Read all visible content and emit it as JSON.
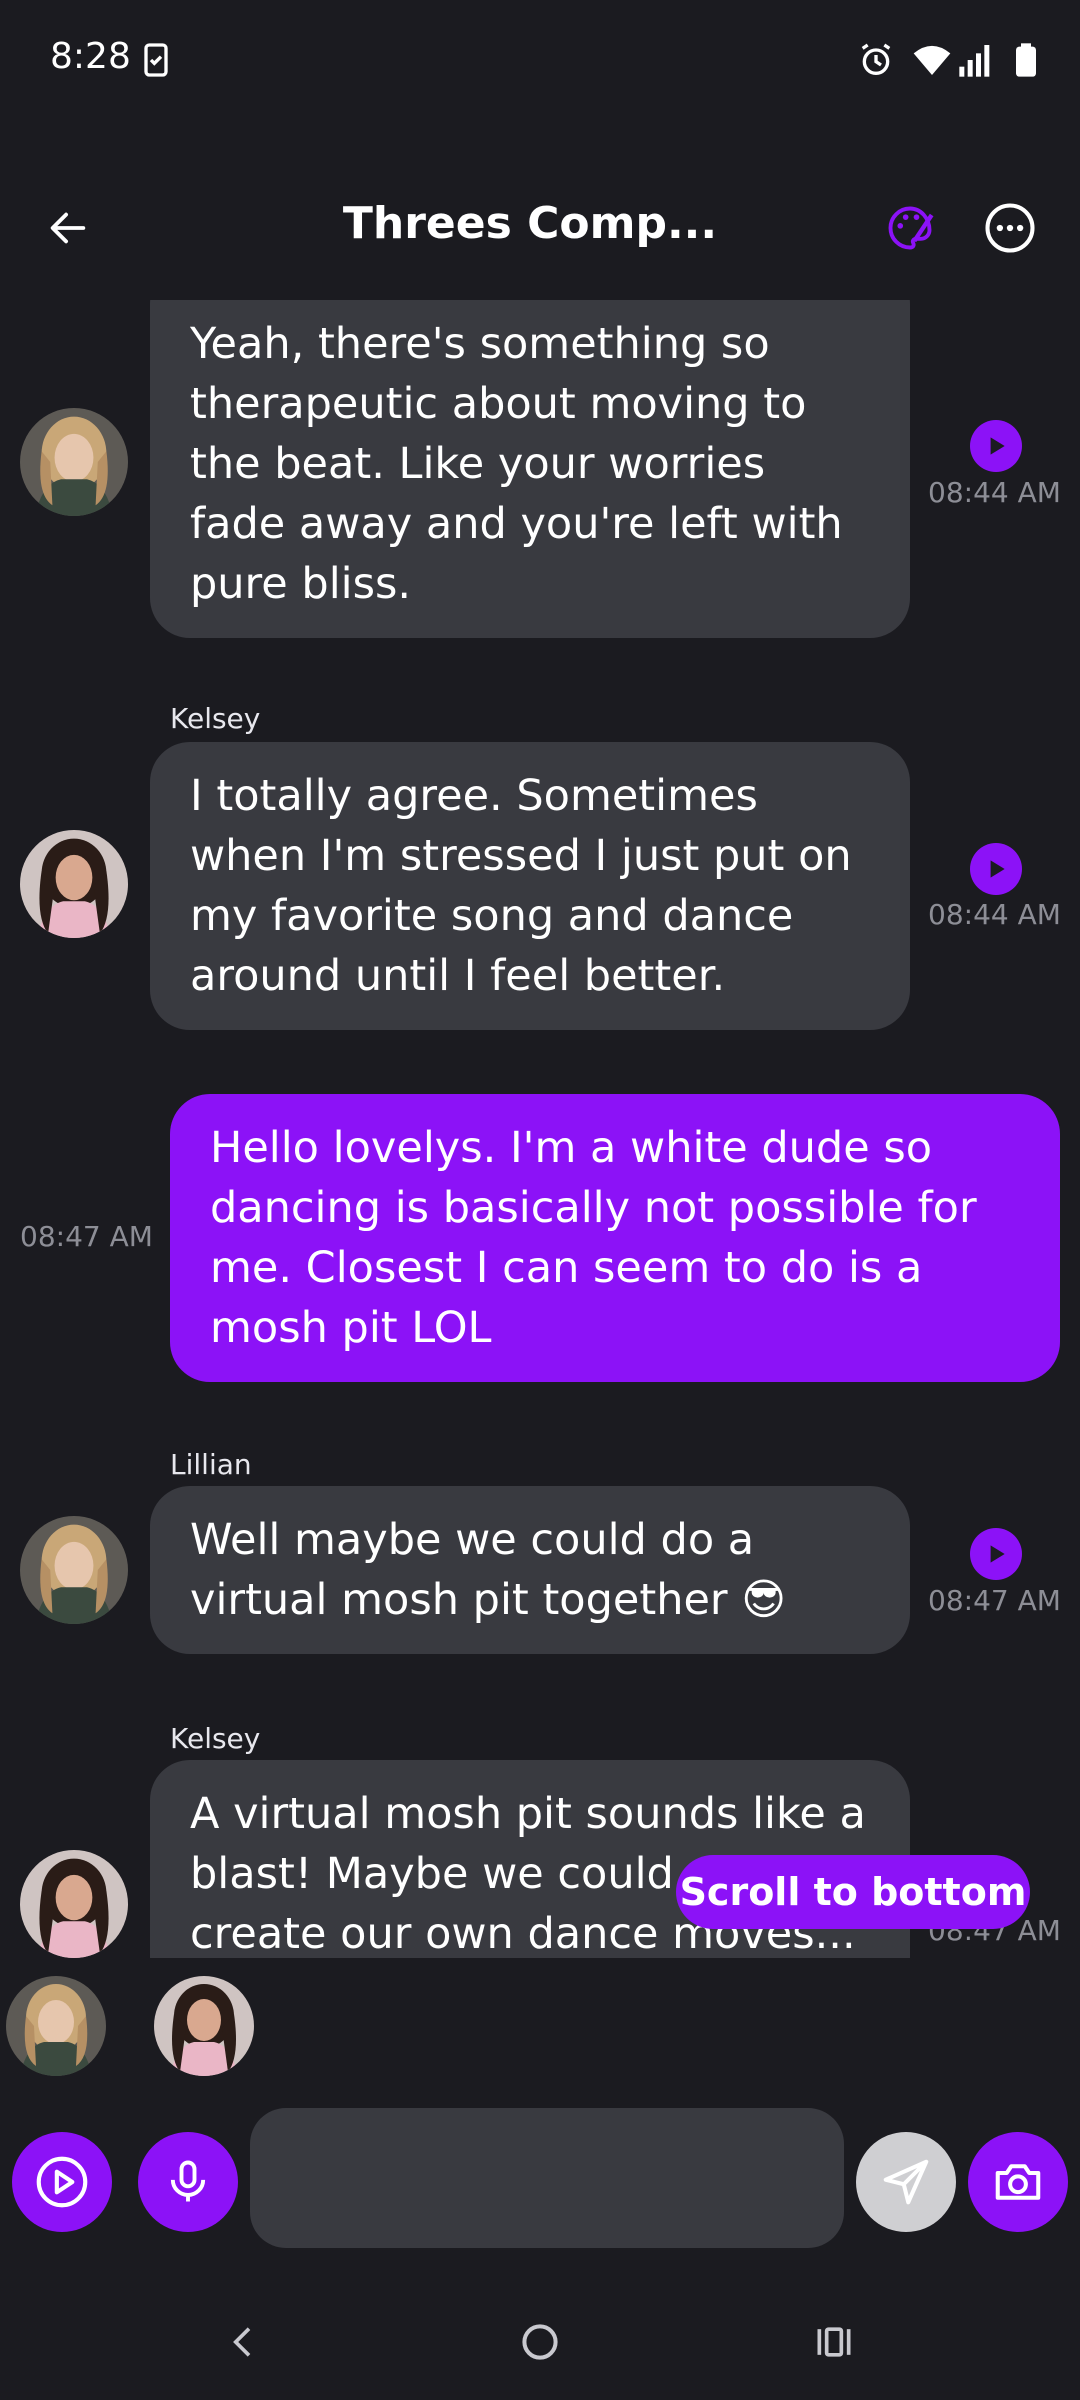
{
  "status_bar": {
    "time": "8:28",
    "icons": [
      "clipboard-icon",
      "alarm-icon",
      "wifi-icon",
      "signal-icon",
      "battery-icon"
    ]
  },
  "header": {
    "title": "Threes Comp...",
    "back_icon": "back-arrow-icon",
    "theme_icon": "palette-icon",
    "more_icon": "more-options-icon"
  },
  "messages": [
    {
      "sender": "",
      "text": "Yeah, there's something so therapeutic about moving to the beat. Like your worries fade away and you're left with pure bliss.",
      "time": "08:44 AM",
      "own": false
    },
    {
      "sender": "Kelsey",
      "text": "I totally agree. Sometimes when I'm stressed I just put on my favorite song and dance around until I feel better.",
      "time": "08:44 AM",
      "own": false
    },
    {
      "sender": "",
      "text": "Hello lovelys. I'm a white dude so dancing is basically not possible for me. Closest I can seem to do is a mosh pit LOL",
      "time": "08:47 AM",
      "own": true
    },
    {
      "sender": "Lillian",
      "text": "Well maybe we could do a virtual mosh pit together 😎",
      "time": "08:47 AM",
      "own": false
    },
    {
      "sender": "Kelsey",
      "text": "A virtual mosh pit sounds like a blast! Maybe we could even create our own dance moves...",
      "time": "08:47 AM",
      "own": false
    }
  ],
  "scroll_button": {
    "label": "Scroll to bottom"
  },
  "composer": {
    "placeholder": "",
    "buttons": [
      "play-icon",
      "microphone-icon",
      "send-icon",
      "camera-icon"
    ]
  },
  "colors": {
    "background": "#1b1b20",
    "accent": "#8c12f7",
    "bubble": "#393a40",
    "timestamp": "#8d8e96"
  }
}
